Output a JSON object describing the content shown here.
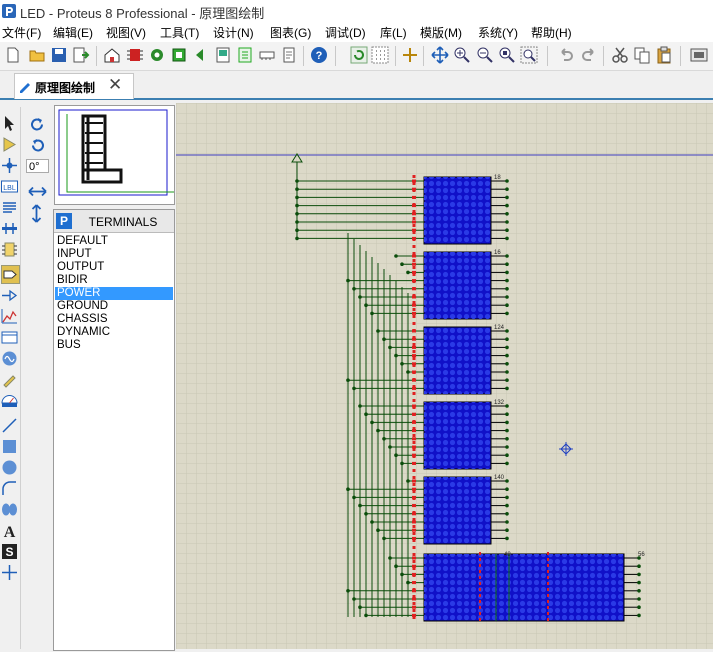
{
  "window": {
    "app_name": "LED",
    "title": "LED - Proteus 8 Professional - 原理图绘制"
  },
  "menu": [
    {
      "id": "file",
      "label": "文件(F)"
    },
    {
      "id": "edit",
      "label": "编辑(E)"
    },
    {
      "id": "view",
      "label": "视图(V)"
    },
    {
      "id": "tools",
      "label": "工具(T)"
    },
    {
      "id": "design",
      "label": "设计(N)"
    },
    {
      "id": "graph",
      "label": "图表(G)"
    },
    {
      "id": "debug",
      "label": "调试(D)"
    },
    {
      "id": "library",
      "label": "库(L)"
    },
    {
      "id": "template",
      "label": "模版(M)"
    },
    {
      "id": "system",
      "label": "系统(Y)"
    },
    {
      "id": "help",
      "label": "帮助(H)"
    }
  ],
  "toolbar_icons": [
    "new-file-icon",
    "open-file-icon",
    "save-icon",
    "import-icon",
    "home-icon",
    "chip-icon",
    "gear-icon",
    "component-icon",
    "back-icon",
    "gallery-icon",
    "schematic-icon",
    "pcb-icon",
    "memory-icon",
    "document-icon",
    "help-icon",
    "refresh-icon",
    "grid-icon",
    "origin-icon",
    "pan-icon",
    "zoom-in-icon",
    "zoom-out-icon",
    "zoom-all-icon",
    "zoom-area-icon",
    "undo-icon",
    "redo-icon",
    "cut-icon",
    "copy-icon",
    "paste-icon",
    "block-copy-icon"
  ],
  "tabs": [
    {
      "label": "原理图绘制",
      "active": true,
      "close_glyph": "✕"
    }
  ],
  "rotation": {
    "angle": "0°"
  },
  "terminals": {
    "badge": "P",
    "title": "TERMINALS",
    "items": [
      "DEFAULT",
      "INPUT",
      "OUTPUT",
      "BIDIR",
      "POWER",
      "GROUND",
      "CHASSIS",
      "DYNAMIC",
      "BUS"
    ],
    "selected": "POWER"
  },
  "schematic": {
    "upper_pin_labels": [
      "18",
      "16",
      "124",
      "132",
      "140"
    ],
    "lower_block_labels": [
      "48",
      "56"
    ]
  },
  "colors": {
    "accent": "#3c7fb1",
    "canvas_bg": "#dcd9c8",
    "grid": "#c9c6b4",
    "wire": "#0b4d0b",
    "led_matrix": "#1010c8",
    "pin_red": "#e02020",
    "selection": "#3399ff"
  }
}
